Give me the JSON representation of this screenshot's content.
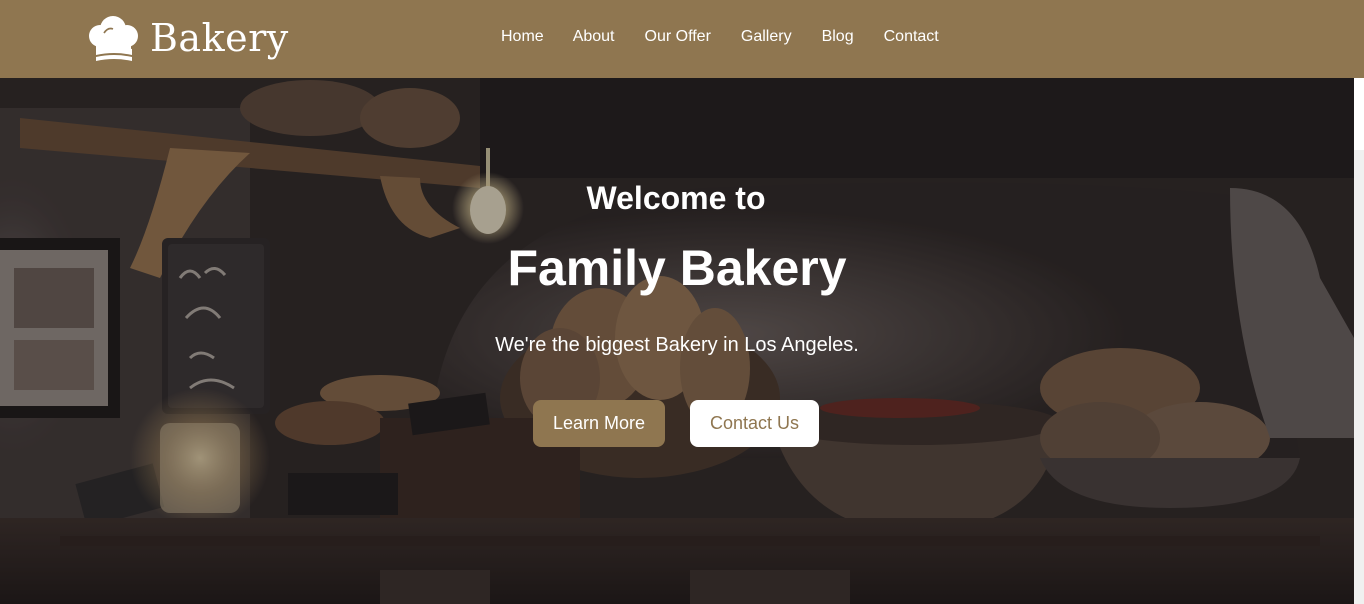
{
  "brand": {
    "name": "Bakery",
    "icon": "chef-hat-icon"
  },
  "nav": {
    "items": [
      {
        "label": "Home"
      },
      {
        "label": "About"
      },
      {
        "label": "Our Offer"
      },
      {
        "label": "Gallery"
      },
      {
        "label": "Blog"
      },
      {
        "label": "Contact"
      }
    ]
  },
  "hero": {
    "welcome": "Welcome to",
    "title": "Family Bakery",
    "subtitle": "We're the biggest Bakery in Los Angeles.",
    "buttons": {
      "learn_more": "Learn More",
      "contact_us": "Contact Us"
    }
  },
  "colors": {
    "brand": "#8f7650",
    "text_light": "#ffffff"
  }
}
